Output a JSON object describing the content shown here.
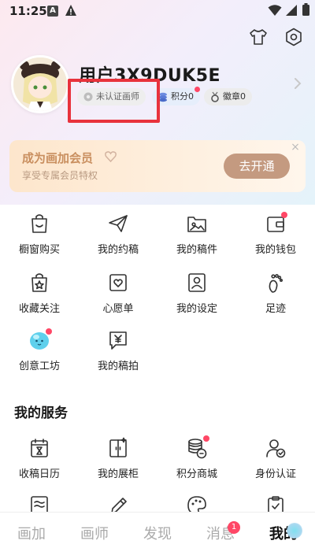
{
  "status_bar": {
    "time": "11:25",
    "notif_a": "A"
  },
  "profile": {
    "username": "用户3X9DUK5E",
    "badges": {
      "certification": "未认证画师",
      "points": "积分0",
      "medals": "徽章0"
    }
  },
  "membership": {
    "title": "成为画加会员",
    "subtitle": "享受专属会员特权",
    "button": "去开通",
    "close": "×"
  },
  "grid": [
    {
      "label": "橱窗购买",
      "icon": "bag-icon"
    },
    {
      "label": "我的约稿",
      "icon": "paper-plane-icon"
    },
    {
      "label": "我的稿件",
      "icon": "folder-image-icon"
    },
    {
      "label": "我的钱包",
      "icon": "wallet-icon"
    },
    {
      "label": "收藏关注",
      "icon": "star-bag-icon"
    },
    {
      "label": "心愿单",
      "icon": "heart-image-icon"
    },
    {
      "label": "我的设定",
      "icon": "profile-card-icon"
    },
    {
      "label": "足迹",
      "icon": "footprint-icon"
    },
    {
      "label": "创意工坊",
      "icon": "creative-blob-icon"
    },
    {
      "label": "我的稿拍",
      "icon": "yen-chat-icon"
    }
  ],
  "services": {
    "title": "我的服务",
    "items": [
      {
        "label": "收稿日历",
        "icon": "calendar-hourglass-icon"
      },
      {
        "label": "我的展柜",
        "icon": "cabinet-icon"
      },
      {
        "label": "积分商城",
        "icon": "coins-stack-icon"
      },
      {
        "label": "身份认证",
        "icon": "person-check-icon"
      },
      {
        "label": "",
        "icon": "wave-doc-icon"
      },
      {
        "label": "",
        "icon": "pencil-icon"
      },
      {
        "label": "",
        "icon": "palette-icon"
      },
      {
        "label": "",
        "icon": "clipboard-check-icon"
      }
    ]
  },
  "tabbar": {
    "tabs": [
      {
        "label": "画加"
      },
      {
        "label": "画师"
      },
      {
        "label": "发现"
      },
      {
        "label": "消息",
        "badge": "1"
      },
      {
        "label": "我的",
        "active": true
      }
    ]
  },
  "colors": {
    "accent_red": "#ff4766",
    "highlight_box": "#e8323c",
    "member_button": "#c49a80"
  }
}
